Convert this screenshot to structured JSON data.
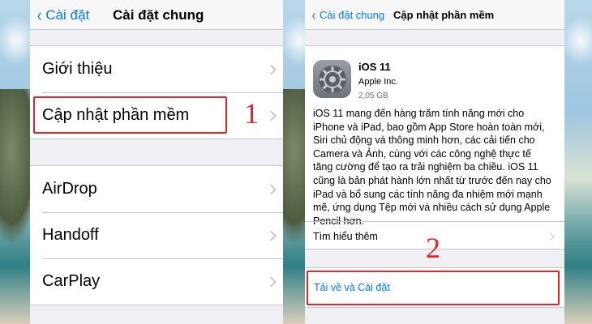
{
  "left_screen": {
    "nav": {
      "back_label": "Cài đặt",
      "title": "Cài đặt chung"
    },
    "group1": [
      {
        "label": "Giới thiệu"
      },
      {
        "label": "Cập nhật phần mềm"
      }
    ],
    "group2": [
      {
        "label": "AirDrop"
      },
      {
        "label": "Handoff"
      },
      {
        "label": "CarPlay"
      }
    ],
    "step_marker": "1"
  },
  "right_screen": {
    "nav": {
      "back_label": "Cài đặt chung",
      "title": "Cập nhật phần mềm"
    },
    "update": {
      "icon": "settings-gear-icon",
      "name": "iOS 11",
      "vendor": "Apple Inc.",
      "size": "2,05 GB",
      "description": "iOS 11 mang đến hàng trăm tính năng mới cho iPhone và iPad, bao gồm App Store hoàn toàn mới, Siri chủ động và thông minh hơn, các cải tiến cho Camera và Ảnh, cùng với các công nghệ thực tế tăng cường để tạo ra trải nghiệm ba chiều. iOS 11 cũng là bản phát hành lớn nhất từ trước đến nay cho iPad và bổ sung các tính năng đa nhiệm mới mạnh mẽ, ứng dụng Tệp mới và nhiều cách sử dụng Apple Pencil hơn.",
      "learn_more": "Tìm hiểu thêm"
    },
    "install_label": "Tải về và Cài đặt",
    "step_marker": "2"
  },
  "colors": {
    "accent": "#007aff",
    "annotation": "#e8232a",
    "background": "#efeff4"
  }
}
